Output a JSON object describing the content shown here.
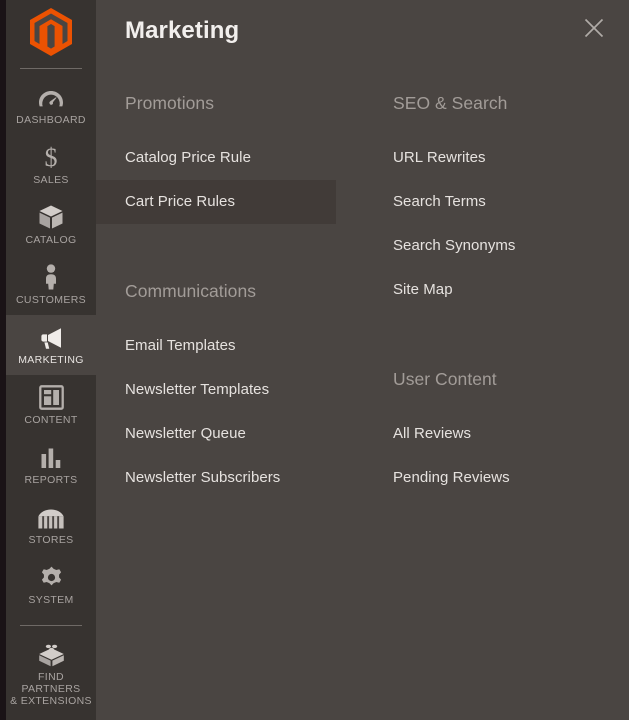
{
  "colors": {
    "brand_orange": "#eb5202",
    "sidebar_bg": "#373330",
    "panel_bg": "#4a4542",
    "edge_strip": "#1a1316",
    "highlight_bg": "#413b38",
    "muted_text": "#a29c98",
    "primary_text": "#e6e2df"
  },
  "sidebar": {
    "logo": {
      "name": "magento-logo",
      "alt": "Magento"
    },
    "items": [
      {
        "label": "Dashboard",
        "icon": "dashboard-gauge-icon",
        "active": false
      },
      {
        "label": "Sales",
        "icon": "dollar-sign-icon",
        "active": false
      },
      {
        "label": "Catalog",
        "icon": "box-icon",
        "active": false
      },
      {
        "label": "Customers",
        "icon": "person-icon",
        "active": false
      },
      {
        "label": "Marketing",
        "icon": "megaphone-icon",
        "active": true
      },
      {
        "label": "Content",
        "icon": "layout-page-icon",
        "active": false
      },
      {
        "label": "Reports",
        "icon": "bar-chart-icon",
        "active": false
      },
      {
        "label": "Stores",
        "icon": "storefront-icon",
        "active": false
      },
      {
        "label": "System",
        "icon": "gear-icon",
        "active": false
      },
      {
        "label": "Find Partners\n& Extensions",
        "icon": "lego-brick-icon",
        "active": false
      }
    ]
  },
  "panel": {
    "title": "Marketing",
    "close_label": "Close",
    "close_icon": "close-x-icon"
  },
  "menu": {
    "left_column": [
      {
        "group_title": "Promotions",
        "items": [
          {
            "label": "Catalog Price Rule",
            "highlighted": false
          },
          {
            "label": "Cart Price Rules",
            "highlighted": true
          }
        ]
      },
      {
        "group_title": "Communications",
        "items": [
          {
            "label": "Email Templates",
            "highlighted": false
          },
          {
            "label": "Newsletter Templates",
            "highlighted": false
          },
          {
            "label": "Newsletter Queue",
            "highlighted": false
          },
          {
            "label": "Newsletter Subscribers",
            "highlighted": false
          }
        ]
      }
    ],
    "right_column": [
      {
        "group_title": "SEO & Search",
        "items": [
          {
            "label": "URL Rewrites",
            "highlighted": false
          },
          {
            "label": "Search Terms",
            "highlighted": false
          },
          {
            "label": "Search Synonyms",
            "highlighted": false
          },
          {
            "label": "Site Map",
            "highlighted": false
          }
        ]
      },
      {
        "group_title": "User Content",
        "items": [
          {
            "label": "All Reviews",
            "highlighted": false
          },
          {
            "label": "Pending Reviews",
            "highlighted": false
          }
        ]
      }
    ]
  }
}
